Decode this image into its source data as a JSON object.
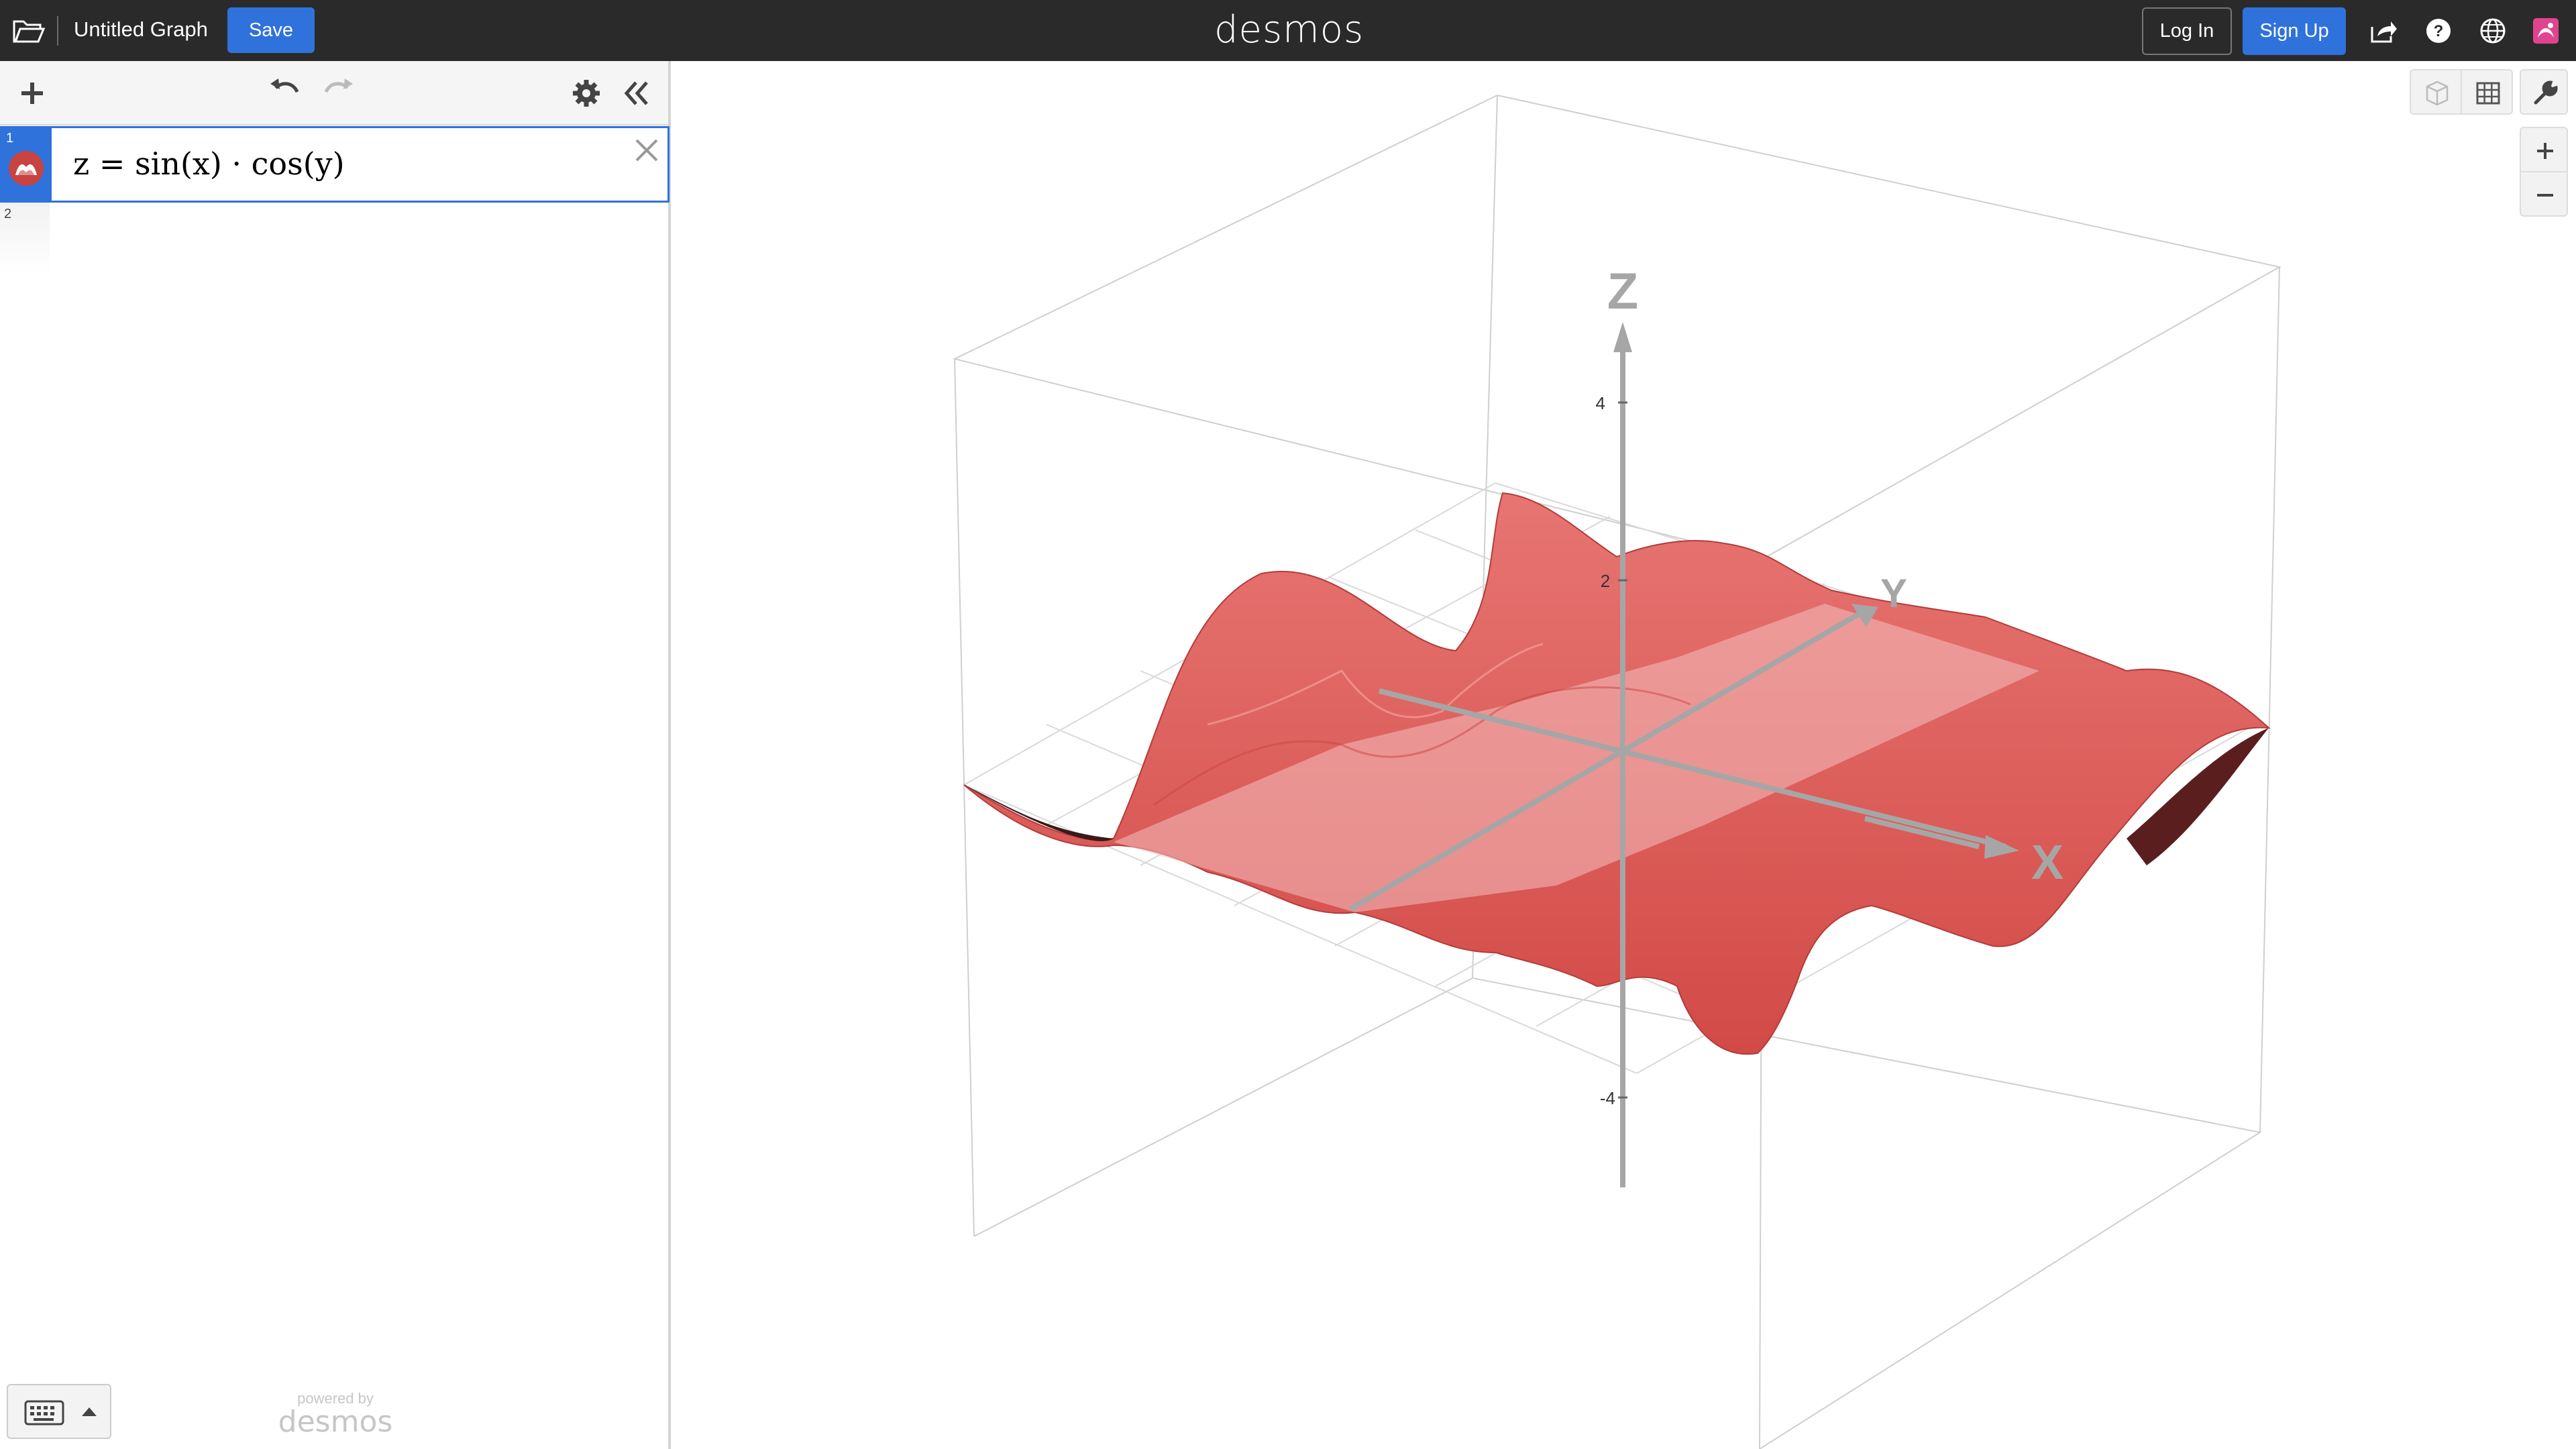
{
  "header": {
    "graph_title": "Untitled Graph",
    "save_label": "Save",
    "logo": "desmos",
    "login_label": "Log In",
    "signup_label": "Sign Up",
    "icons": [
      "folder-icon",
      "share-icon",
      "help-icon",
      "globe-icon",
      "user-icon"
    ]
  },
  "expression_list": {
    "expressions": [
      {
        "index": "1",
        "latex_display": "z = sin(x) · cos(y)",
        "color": "#c74440"
      },
      {
        "index": "2",
        "latex_display": ""
      }
    ]
  },
  "footer": {
    "powered_by": "powered by",
    "brand": "desmos"
  },
  "graph": {
    "axis_labels": {
      "x": "X",
      "y": "Y",
      "z": "Z"
    },
    "tick_labels": {
      "z_pos_4": "4",
      "z_pos_2": "2",
      "z_neg_4": "-4"
    },
    "surface_color": "#e05a58",
    "function": "z = sin(x) · cos(y)"
  },
  "colors": {
    "accent": "#2f72dc",
    "topbar": "#2a2a2a"
  }
}
